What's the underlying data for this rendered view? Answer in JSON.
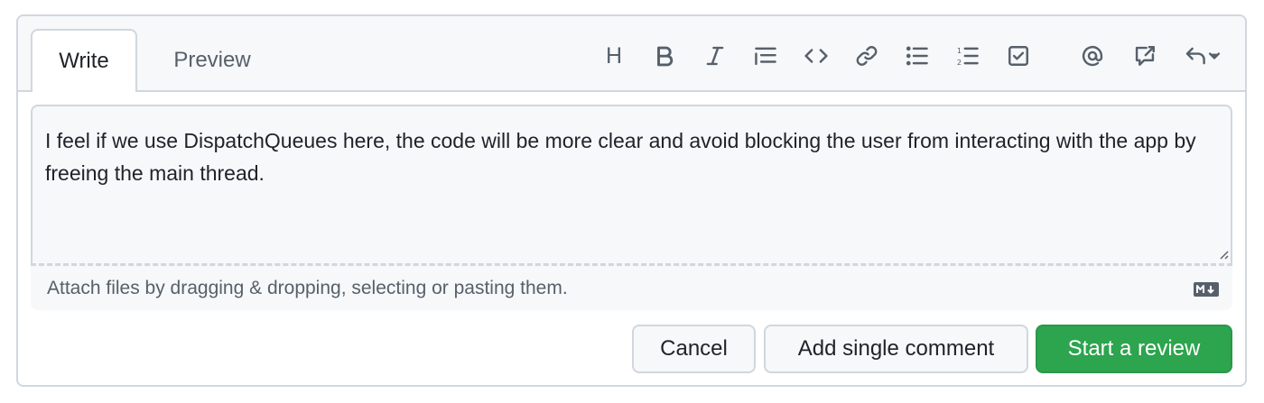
{
  "tabs": {
    "write": "Write",
    "preview": "Preview"
  },
  "toolbar": {
    "heading_label": "H",
    "icons": [
      "heading-icon",
      "bold-icon",
      "italic-icon",
      "quote-icon",
      "code-icon",
      "link-icon",
      "unordered-list-icon",
      "ordered-list-icon",
      "task-list-icon",
      "mention-icon",
      "reference-icon",
      "reply-icon"
    ]
  },
  "editor": {
    "value": "I feel if we use DispatchQueues here, the code will be more clear and avoid blocking the user from interacting with the app by freeing the main thread."
  },
  "attach": {
    "hint": "Attach files by dragging & dropping, selecting or pasting them."
  },
  "actions": {
    "cancel": "Cancel",
    "add_single": "Add single comment",
    "start_review": "Start a review"
  },
  "colors": {
    "primary_button": "#2da44e",
    "border": "#d0d7de",
    "muted_text": "#57606a"
  }
}
